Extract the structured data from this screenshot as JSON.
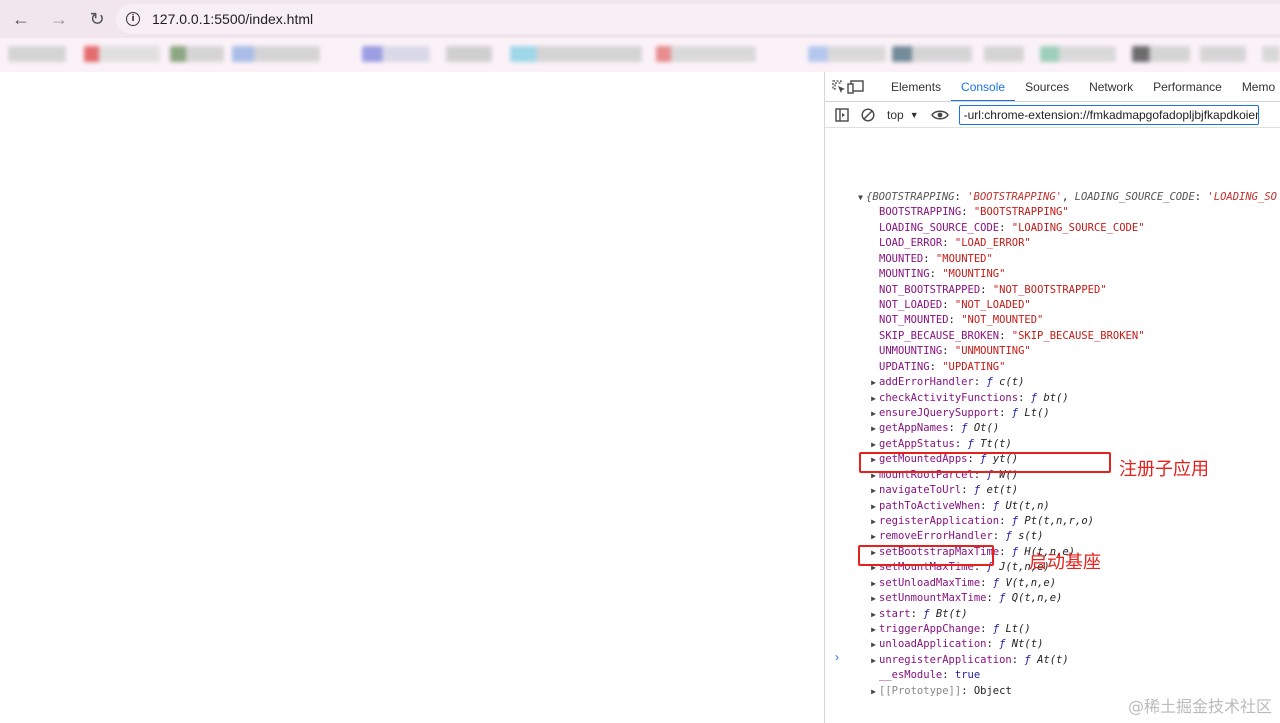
{
  "browser": {
    "url": "127.0.0.1:5500/index.html"
  },
  "devtools": {
    "tabs": [
      "Elements",
      "Console",
      "Sources",
      "Network",
      "Performance",
      "Memo"
    ],
    "active_tab": "Console",
    "context": "top",
    "filter_value": "-url:chrome-extension://fmkadmapgofadopljbjfkapdkoienihi"
  },
  "console": {
    "summary": {
      "open": "{",
      "k1": "BOOTSTRAPPING",
      "v1": "'BOOTSTRAPPING'",
      "k2": "LOADING_SOURCE_CODE",
      "v2": "'LOADING_SO"
    },
    "constants": [
      {
        "key": "BOOTSTRAPPING",
        "value": "\"BOOTSTRAPPING\""
      },
      {
        "key": "LOADING_SOURCE_CODE",
        "value": "\"LOADING_SOURCE_CODE\""
      },
      {
        "key": "LOAD_ERROR",
        "value": "\"LOAD_ERROR\""
      },
      {
        "key": "MOUNTED",
        "value": "\"MOUNTED\""
      },
      {
        "key": "MOUNTING",
        "value": "\"MOUNTING\""
      },
      {
        "key": "NOT_BOOTSTRAPPED",
        "value": "\"NOT_BOOTSTRAPPED\""
      },
      {
        "key": "NOT_LOADED",
        "value": "\"NOT_LOADED\""
      },
      {
        "key": "NOT_MOUNTED",
        "value": "\"NOT_MOUNTED\""
      },
      {
        "key": "SKIP_BECAUSE_BROKEN",
        "value": "\"SKIP_BECAUSE_BROKEN\""
      },
      {
        "key": "UNMOUNTING",
        "value": "\"UNMOUNTING\""
      },
      {
        "key": "UPDATING",
        "value": "\"UPDATING\""
      }
    ],
    "functions": [
      {
        "key": "addErrorHandler",
        "sig": "c(t)"
      },
      {
        "key": "checkActivityFunctions",
        "sig": "bt()"
      },
      {
        "key": "ensureJQuerySupport",
        "sig": "Lt()"
      },
      {
        "key": "getAppNames",
        "sig": "Ot()"
      },
      {
        "key": "getAppStatus",
        "sig": "Tt(t)"
      },
      {
        "key": "getMountedApps",
        "sig": "yt()"
      },
      {
        "key": "mountRootParcel",
        "sig": "W()"
      },
      {
        "key": "navigateToUrl",
        "sig": "et(t)"
      },
      {
        "key": "pathToActiveWhen",
        "sig": "Ut(t,n)"
      },
      {
        "key": "registerApplication",
        "sig": "Pt(t,n,r,o)"
      },
      {
        "key": "removeErrorHandler",
        "sig": "s(t)"
      },
      {
        "key": "setBootstrapMaxTime",
        "sig": "H(t,n,e)"
      },
      {
        "key": "setMountMaxTime",
        "sig": "J(t,n,e)"
      },
      {
        "key": "setUnloadMaxTime",
        "sig": "V(t,n,e)"
      },
      {
        "key": "setUnmountMaxTime",
        "sig": "Q(t,n,e)"
      },
      {
        "key": "start",
        "sig": "Bt(t)"
      },
      {
        "key": "triggerAppChange",
        "sig": "Lt()"
      },
      {
        "key": "unloadApplication",
        "sig": "Nt(t)"
      },
      {
        "key": "unregisterApplication",
        "sig": "At(t)"
      }
    ],
    "esmodule": {
      "key": "__esModule",
      "value": "true"
    },
    "prototype": {
      "key": "[[Prototype]]",
      "value": "Object"
    },
    "fn_symbol": "ƒ"
  },
  "annotations": {
    "register": "注册子应用",
    "start": "启动基座"
  },
  "watermark": "@稀土掘金技术社区",
  "colors": {
    "highlight": "#e5211d",
    "accent": "#1a73e8"
  }
}
